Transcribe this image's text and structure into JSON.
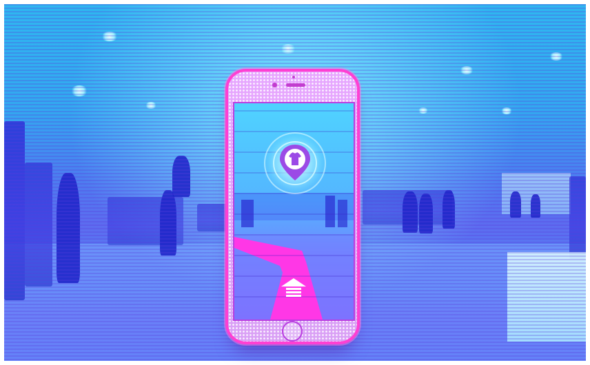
{
  "scene": {
    "subject": "",
    "colors": {
      "accent_magenta": "#ff3fd2",
      "pin_purple": "#9b4ae6",
      "scene_cyan": "#33b8f2",
      "scene_blue": "#5a6cf0"
    }
  },
  "phone": {
    "screen": {
      "marker_icon": "shirt-location-pin-icon",
      "direction_icon": "forward-arrow-icon"
    }
  }
}
